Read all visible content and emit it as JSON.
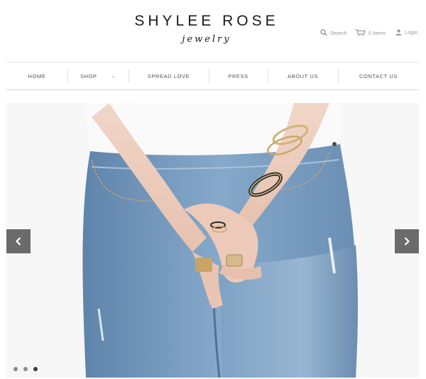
{
  "brand": {
    "name": "SHYLEE ROSE",
    "sub": "jewelry"
  },
  "utility": {
    "search_label": "Search",
    "cart_label": "0 items",
    "login_label": "Login"
  },
  "nav": {
    "items": [
      {
        "label": "HOME"
      },
      {
        "label": "SHOP",
        "has_dropdown": true
      },
      {
        "label": "SPREAD LOVE"
      },
      {
        "label": "PRESS"
      },
      {
        "label": "ABOUT US"
      },
      {
        "label": "CONTACT US"
      }
    ]
  },
  "slider": {
    "slide_count": 3,
    "active_index": 2,
    "icons": {
      "prev": "chevron-left-icon",
      "next": "chevron-right-icon"
    }
  },
  "colors": {
    "text_dark": "#1a1a1a",
    "muted": "#9a9a9a",
    "arrow_bg": "#6b6b6b",
    "denim": "#7fa3c6"
  }
}
